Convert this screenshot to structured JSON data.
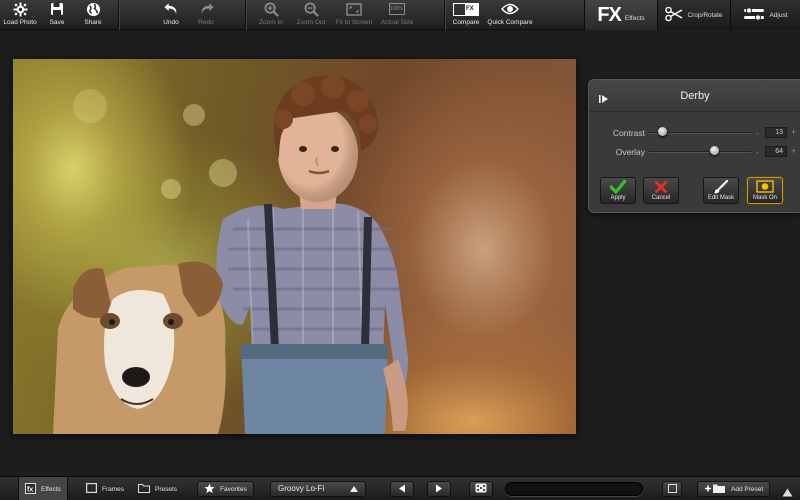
{
  "toolbar": {
    "load_photo": "Load Photo",
    "save": "Save",
    "share": "Share",
    "undo": "Undo",
    "redo": "Redo",
    "zoom_in": "Zoom In",
    "zoom_out": "Zoom Out",
    "fit_to_screen": "Fit to Screen",
    "actual_size": "Actual Size",
    "actual_size_badge": "100%",
    "compare": "Compare",
    "quick_compare": "Quick Compare",
    "compare_badge": "FX"
  },
  "modes": {
    "effects_big": "FX",
    "effects": "Effects",
    "crop_rotate": "Crop/Rotate",
    "adjust": "Adjust"
  },
  "panel": {
    "title": "Derby",
    "contrast_label": "Contrast",
    "contrast_value": "13",
    "contrast_level": 0.13,
    "overlay_label": "Overlay",
    "overlay_value": "64",
    "overlay_level": 0.64,
    "minus": "-",
    "plus": "+",
    "apply": "Apply",
    "cancel": "Cancel",
    "edit_mask": "Edit Mask",
    "mask_on": "Mask On"
  },
  "bottom": {
    "effects": "Effects",
    "frames": "Frames",
    "presets": "Presets",
    "favorites": "Favorites",
    "preset_name": "Groovy Lo-Fi",
    "search_placeholder": "",
    "add_preset": "Add Preset"
  },
  "colors": {
    "accent_yellow": "#f2c200",
    "apply_green": "#35c423",
    "cancel_red": "#e2312b"
  }
}
